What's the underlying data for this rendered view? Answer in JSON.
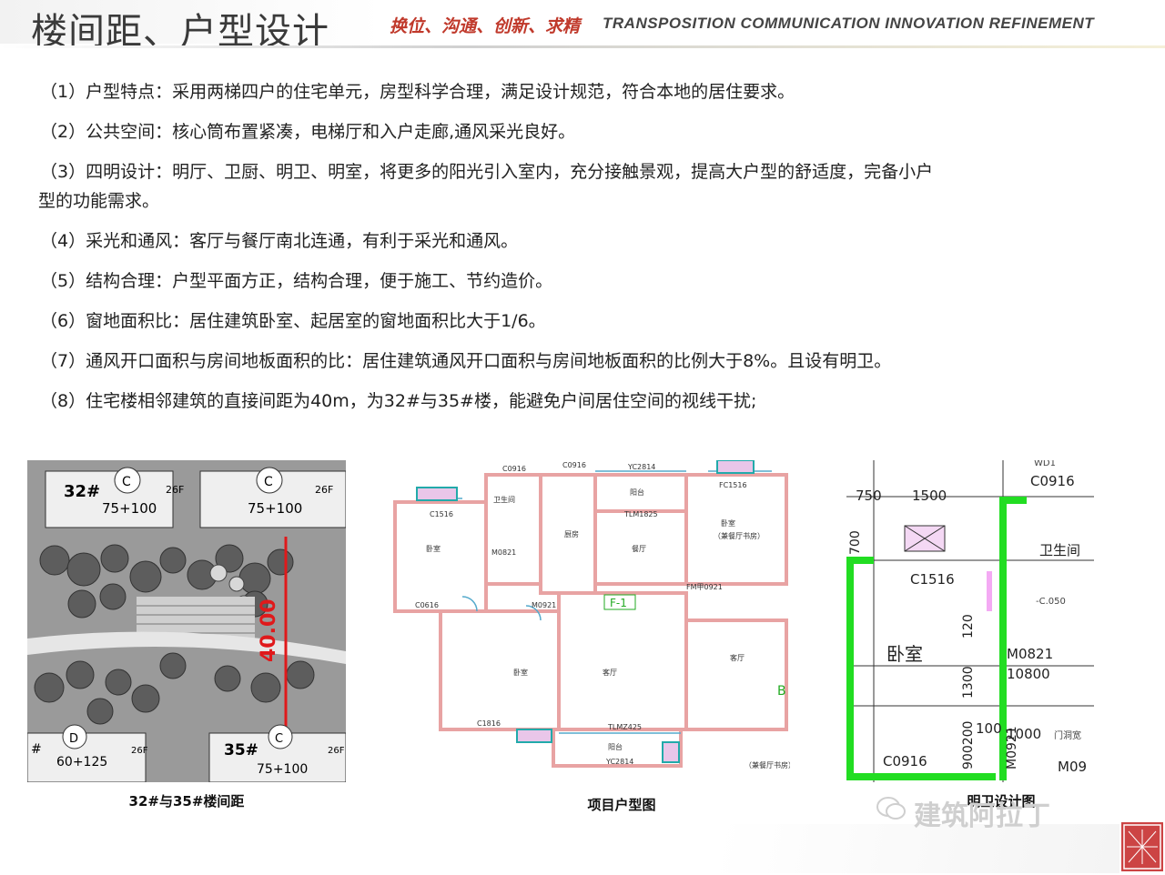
{
  "header": {
    "title": "楼间距、户型设计",
    "slogan": "换位、沟通、创新、求精",
    "tagline": "TRANSPOSITION COMMUNICATION INNOVATION REFINEMENT"
  },
  "paragraphs": [
    "（1）户型特点：采用两梯四户的住宅单元，房型科学合理，满足设计规范，符合本地的居住要求。",
    "（2）公共空间：核心筒布置紧凑，电梯厅和入户走廊,通风采光良好。",
    "（3）四明设计：明厅、卫厨、明卫、明室，将更多的阳光引入室内，充分接触景观，提高大户型的舒适度，完备小户",
    "型的功能需求。",
    "（4）采光和通风：客厅与餐厅南北连通，有利于采光和通风。",
    "（5）结构合理：户型平面方正，结构合理，便于施工、节约造价。",
    "（6）窗地面积比：居住建筑卧室、起居室的窗地面积比大于1/6。",
    "（7）通风开口面积与房间地板面积的比：居住建筑通风开口面积与房间地板面积的比例大于8%。且设有明卫。",
    "（8）住宅楼相邻建筑的直接间距为40m，为32#与35#楼，能避免户间居住空间的视线干扰;"
  ],
  "figures": {
    "site": {
      "caption": "32#与35#楼间距",
      "labels": {
        "b32": "32#",
        "b35": "35#",
        "t1": "75+100",
        "t2": "75+100",
        "t3": "75+100",
        "t4": "60+125",
        "f1": "26F",
        "f2": "26F",
        "f3": "26F",
        "f4": "26F",
        "c1": "C",
        "c2": "C",
        "c3": "C",
        "d1": "D",
        "dist": "40.00",
        "hash": "#"
      }
    },
    "plan": {
      "caption": "项目户型图",
      "labels": {
        "c0916a": "C0916",
        "c0916b": "C0916",
        "yc2814a": "YC2814",
        "fc1516": "FC1516",
        "c1516": "C1516",
        "wsj": "卫生间",
        "yt1": "阳台",
        "tlm1825": "TLM1825",
        "ws1": "卧室",
        "ws2": "卧室",
        "ws3": "卧室",
        "cf": "厨房",
        "ct": "餐厅",
        "kt": "客厅",
        "kt2": "客厅",
        "m0821": "M0821",
        "c0616": "C0616",
        "m0921": "M0921",
        "fm": "FM甲0921",
        "f1": "F-1",
        "tlmz": "TLMZ425",
        "yt2": "阳台",
        "yc2814b": "YC2814",
        "c1816": "C1816",
        "b": "B",
        "sub1": "（兼餐厅书房）",
        "sub2": "（兼餐厅书房）"
      }
    },
    "detail": {
      "caption": "明卫设计图",
      "labels": {
        "wd": "WD1",
        "c0916": "C0916",
        "d750": "750",
        "d1500": "1500",
        "d700": "700",
        "wsj": "卫生间",
        "c1516": "C1516",
        "ws": "卧室",
        "d120": "120",
        "m0821": "M0821",
        "d10800": "10800",
        "d1300": "1300",
        "d900200": "900200",
        "d100": "100",
        "d1000": "1000",
        "m0921": "M0921",
        "c0916b": "C0916",
        "m09": "M09",
        "c050": "-C.050",
        "xj": "门洞宽"
      }
    }
  },
  "watermark": "建筑阿拉丁",
  "colors": {
    "accent": "#c0392b",
    "plan_wall": "#e8a3a3",
    "detail_green": "#22dd22"
  }
}
